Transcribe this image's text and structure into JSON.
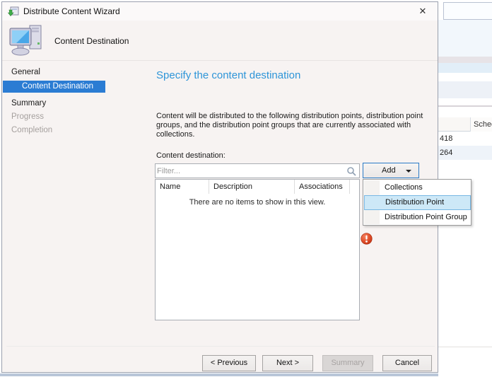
{
  "window": {
    "title": "Distribute Content Wizard",
    "close_glyph": "✕"
  },
  "header": {
    "title": "Content Destination"
  },
  "sidebar": {
    "items": [
      {
        "label": "General",
        "state": "normal"
      },
      {
        "label": "Content Destination",
        "state": "active"
      },
      {
        "label": "Summary",
        "state": "normal"
      },
      {
        "label": "Progress",
        "state": "disabled"
      },
      {
        "label": "Completion",
        "state": "disabled"
      }
    ]
  },
  "content": {
    "heading": "Specify the content destination",
    "description": "Content will be distributed to the following distribution points, distribution point groups, and the distribution point groups that are currently associated with collections.",
    "list_label": "Content destination:",
    "filter_placeholder": "Filter...",
    "columns": [
      "Name",
      "Description",
      "Associations"
    ],
    "empty_text": "There are no items to show in this view.",
    "add_button_label": "Add",
    "menu": {
      "items": [
        "Collections",
        "Distribution Point",
        "Distribution Point Group"
      ],
      "highlighted": "Distribution Point"
    }
  },
  "footer": {
    "previous_label": "< Previous",
    "next_label": "Next >",
    "summary_label": "Summary",
    "cancel_label": "Cancel"
  },
  "background_window": {
    "column_header": "Sched",
    "rows": [
      "418",
      "264"
    ]
  },
  "colors": {
    "heading_blue": "#2e95d8",
    "nav_active_blue": "#2b7cd3",
    "menu_highlight_bg": "#cde8f7",
    "menu_highlight_border": "#78b7e3",
    "add_button_border": "#2a7ac6",
    "error_red": "#d8391b",
    "dialog_bg": "#f7f3f2"
  }
}
